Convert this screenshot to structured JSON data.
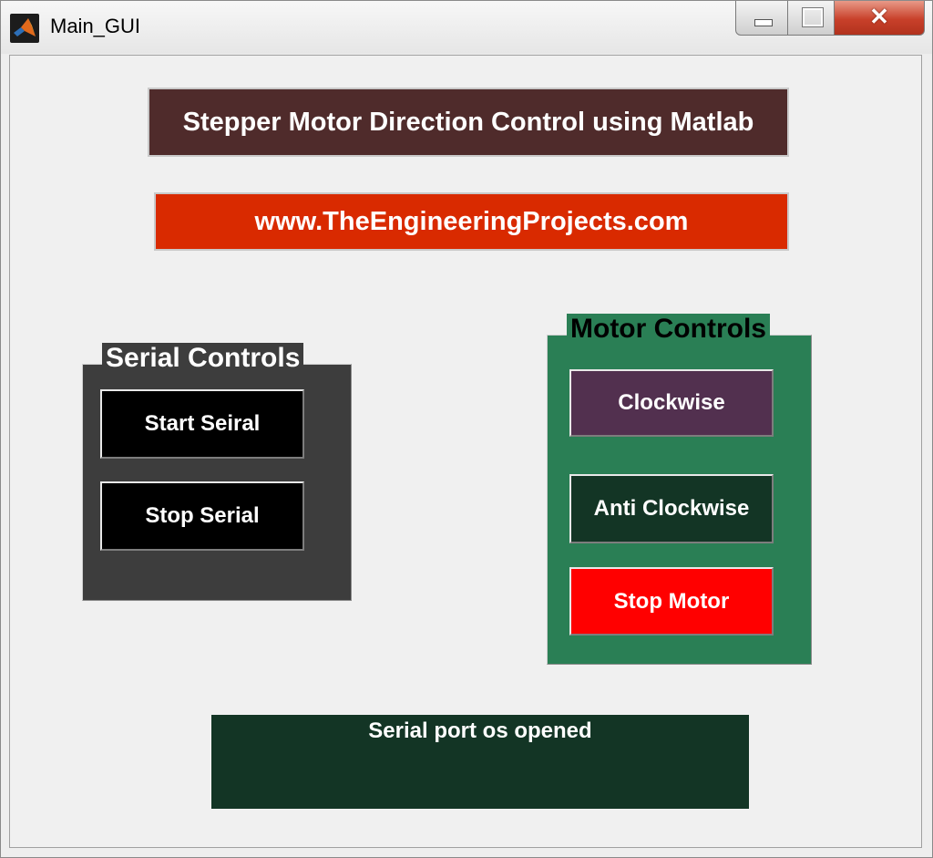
{
  "window": {
    "title": "Main_GUI",
    "controls": {
      "minimize_icon": "minimize-icon",
      "maximize_icon": "maximize-icon",
      "close_icon": "close-icon"
    }
  },
  "header": {
    "title": "Stepper Motor Direction Control using Matlab",
    "url": "www.TheEngineeringProjects.com"
  },
  "serial_panel": {
    "title": "Serial Controls",
    "start_label": "Start Seiral",
    "stop_label": "Stop Serial"
  },
  "motor_panel": {
    "title": "Motor Controls",
    "clockwise_label": "Clockwise",
    "anticlockwise_label": "Anti Clockwise",
    "stop_label": "Stop Motor"
  },
  "status": {
    "message": "Serial port os opened"
  },
  "colors": {
    "title_banner_bg": "#4f2b2b",
    "url_banner_bg": "#d92a00",
    "serial_panel_bg": "#3d3d3d",
    "motor_panel_bg": "#2a7f55",
    "clockwise_bg": "#52304f",
    "anticlockwise_bg": "#133525",
    "stop_motor_bg": "#ff0000",
    "status_bg": "#133525"
  }
}
